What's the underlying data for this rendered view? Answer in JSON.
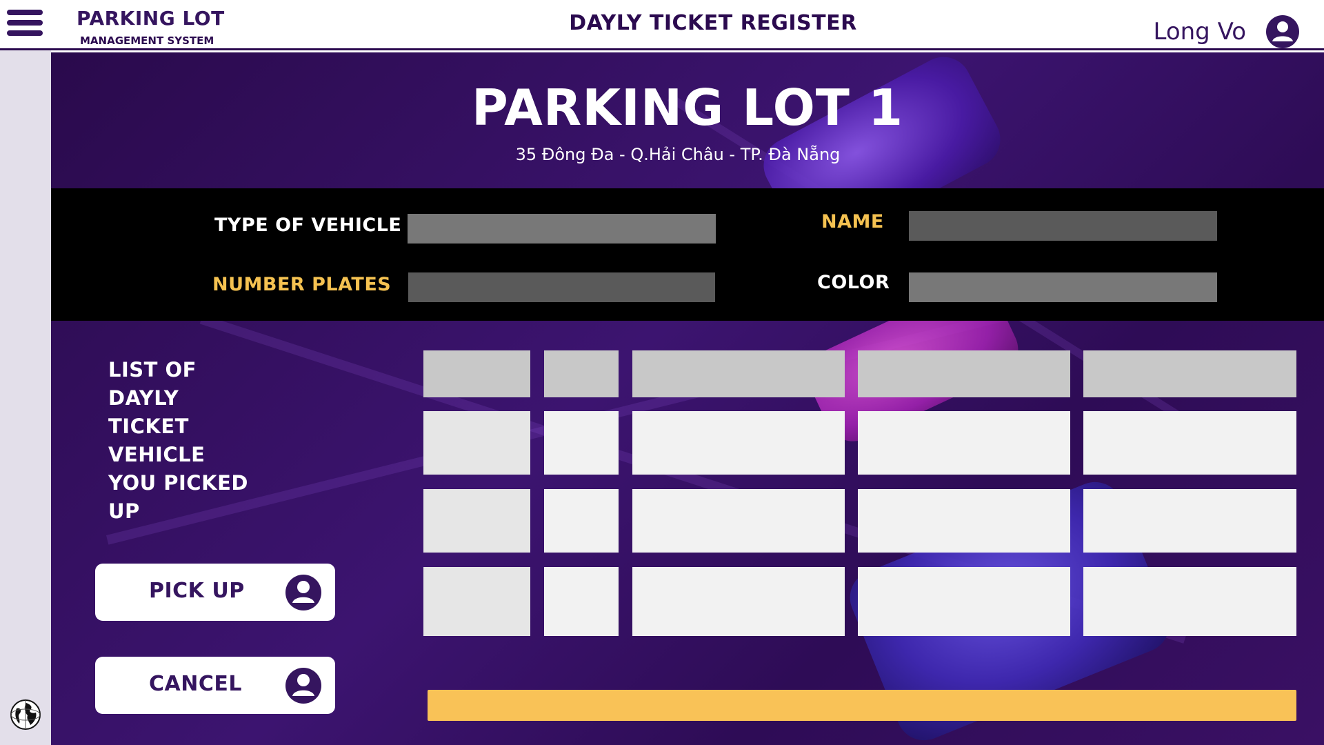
{
  "header": {
    "brand_title": "PARKING LOT",
    "brand_subtitle": "MANAGEMENT SYSTEM",
    "page_heading": "DAYLY TICKET REGISTER",
    "user_name": "Long Vo"
  },
  "lot": {
    "title": "PARKING LOT 1",
    "address": "35 Đông Đa - Q.Hải Châu - TP. Đà Nẵng"
  },
  "form": {
    "type_of_vehicle_label": "TYPE OF VEHICLE",
    "type_of_vehicle_value": "",
    "name_label": "NAME",
    "name_value": "",
    "number_plates_label": "NUMBER PLATES",
    "number_plates_value": "",
    "color_label": "COLOR",
    "color_value": ""
  },
  "list": {
    "label_lines": [
      "LIST OF",
      "DAYLY",
      "TICKET",
      "VEHICLE",
      "YOU PICKED",
      "UP"
    ],
    "columns": [
      "",
      "",
      "",
      "",
      ""
    ],
    "rows": [
      [
        "",
        "",
        "",
        "",
        ""
      ],
      [
        "",
        "",
        "",
        "",
        ""
      ],
      [
        "",
        "",
        "",
        "",
        ""
      ]
    ]
  },
  "actions": {
    "pick_up_label": "PICK UP",
    "cancel_label": "CANCEL"
  },
  "progress": {
    "value": 1.0
  },
  "colors": {
    "brand_purple": "#35155f",
    "accent_yellow": "#f5c251",
    "form_band": "#000000"
  },
  "icons": {
    "menu": "hamburger-menu-icon",
    "user": "user-avatar-icon",
    "globe": "globe-icon"
  }
}
